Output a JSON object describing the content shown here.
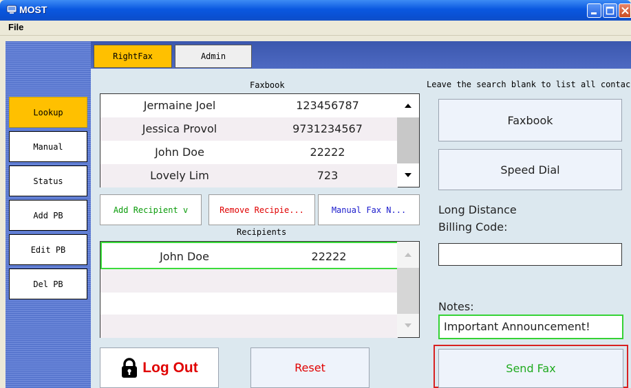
{
  "window": {
    "title": "MOST",
    "menu": [
      "File"
    ]
  },
  "tabs": [
    "RightFax",
    "Admin"
  ],
  "active_tab": "RightFax",
  "sidebar": {
    "items": [
      {
        "label": "Lookup",
        "active": true
      },
      {
        "label": "Manual"
      },
      {
        "label": "Status"
      },
      {
        "label": "Add PB"
      },
      {
        "label": "Edit PB"
      },
      {
        "label": "Del PB"
      }
    ]
  },
  "faxbook": {
    "title": "Faxbook",
    "rows": [
      {
        "name": "Jermaine Joel",
        "number": "123456787"
      },
      {
        "name": "Jessica Provol",
        "number": "9731234567"
      },
      {
        "name": "John Doe",
        "number": "22222"
      },
      {
        "name": "Lovely Lim",
        "number": "723"
      }
    ]
  },
  "actions": {
    "add_recipient": "Add Recipient v",
    "remove_recipient": "Remove Recipie...",
    "manual_fax": "Manual Fax N..."
  },
  "recipients": {
    "title": "Recipients",
    "rows": [
      {
        "name": "John Doe",
        "number": "22222",
        "selected": true
      }
    ]
  },
  "search": {
    "hint": "Leave the search blank to list all contacts",
    "faxbook_button": "Faxbook",
    "speed_dial_button": "Speed Dial"
  },
  "billing": {
    "line1": "Long Distance",
    "line2": "Billing Code:",
    "value": ""
  },
  "notes": {
    "label": "Notes:",
    "value": "Important Announcement!"
  },
  "buttons": {
    "logout": "Log Out",
    "reset": "Reset",
    "send_fax": "Send Fax"
  },
  "colors": {
    "active_tab": "#ffc000",
    "add_recipient_text": "#0a9b0a",
    "remove_recipient_text": "#e00000",
    "manual_fax_text": "#1a1acc",
    "send_fax_text": "#1faa1f",
    "selected_outline": "#3adc3a"
  }
}
